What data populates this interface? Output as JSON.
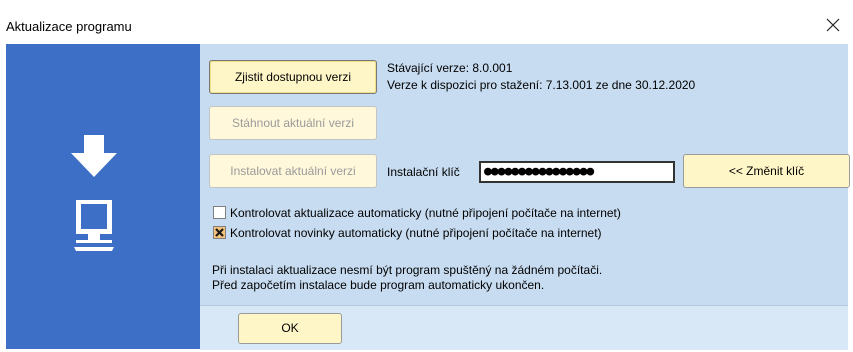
{
  "window": {
    "title": "Aktualizace programu",
    "close_icon": "close-icon"
  },
  "buttons": {
    "check_label": "Zjistit dostupnou verzi",
    "download_label": "Stáhnout aktuální verzi",
    "install_label": "Instalovat aktuální verzi",
    "change_key_label": "<< Změnit klíč",
    "ok_label": "OK"
  },
  "info": {
    "current_version": "Stávající verze: 8.0.001",
    "available_version": "Verze k dispozici pro stažení: 7.13.001 ze dne 30.12.2020"
  },
  "install_key": {
    "label": "Instalační klíč",
    "value": "●●●●●●●●●●●●●●●●"
  },
  "options": {
    "auto_update_label": "Kontrolovat aktualizace automaticky (nutné připojení počítače na internet)",
    "auto_update_checked": false,
    "auto_news_label": "Kontrolovat novinky automaticky (nutné připojení počítače na internet)",
    "auto_news_checked": true
  },
  "notes": {
    "line1": "Při instalaci aktualizace nesmí být program spuštěný na žádném počítači.",
    "line2": "Před započetím instalace bude program automaticky ukončen."
  },
  "colors": {
    "left_panel": "#3d6fc6",
    "content_bg": "#c7dcf1",
    "button_bg": "#fff6c8"
  },
  "icons": [
    "download-arrow-icon",
    "computer-monitor-icon"
  ]
}
